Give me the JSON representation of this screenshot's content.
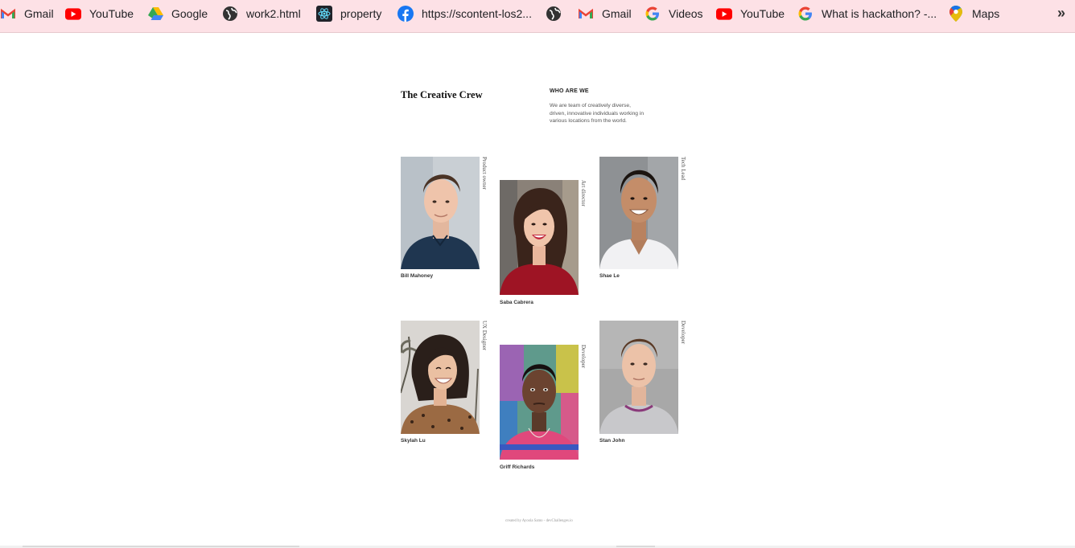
{
  "bookmarks": [
    {
      "label": "Gmail",
      "icon": "gmail-icon"
    },
    {
      "label": "YouTube",
      "icon": "youtube-icon"
    },
    {
      "label": "Google",
      "icon": "google-drive-icon"
    },
    {
      "label": "work2.html",
      "icon": "globe-icon"
    },
    {
      "label": "property",
      "icon": "react-icon"
    },
    {
      "label": "https://scontent-los2...",
      "icon": "facebook-icon"
    },
    {
      "label": "",
      "icon": "globe-icon"
    },
    {
      "label": "Gmail",
      "icon": "gmail-icon"
    },
    {
      "label": "Videos",
      "icon": "google-icon"
    },
    {
      "label": "YouTube",
      "icon": "youtube-icon"
    },
    {
      "label": "What is hackathon? -...",
      "icon": "google-icon"
    },
    {
      "label": "Maps",
      "icon": "google-maps-icon"
    }
  ],
  "more_label": "»",
  "page": {
    "title": "The Creative Crew",
    "who_heading": "WHO ARE WE",
    "who_text": "We are team of creatively diverse, driven, innovative individuals working in various locations from the world."
  },
  "team": [
    {
      "name": "Bill Mahoney",
      "role": "Product owner"
    },
    {
      "name": "Saba Cabrera",
      "role": "Art director"
    },
    {
      "name": "Shae Le",
      "role": "Tech Lead"
    },
    {
      "name": "Skylah Lu",
      "role": "UX Designer"
    },
    {
      "name": "Griff Richards",
      "role": "Developer"
    },
    {
      "name": "Stan John",
      "role": "Developer"
    }
  ],
  "footer": "created by Ayoola Samo - devChallenges.io",
  "colors": {
    "bookmarks_bar": "#fde1e6",
    "youtube_red": "#ff0000",
    "facebook_blue": "#1877f2"
  }
}
